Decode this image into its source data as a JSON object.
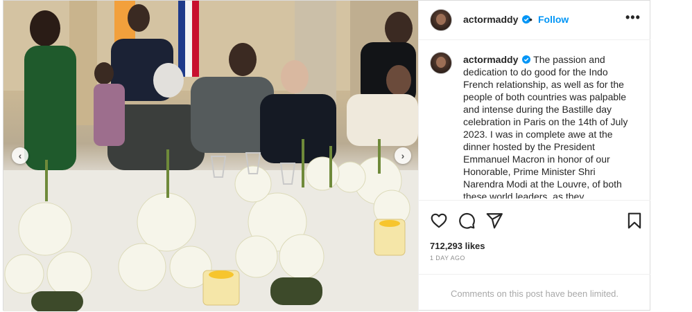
{
  "post": {
    "username": "actormaddy",
    "follow_label": "Follow",
    "separator": "•",
    "more_label": "•••",
    "caption_text": "The passion and dedication to do good for the Indo French relationship, as well as for the people of both countries was palpable and intense during the Bastille day celebration in Paris on the 14th of July 2023. I was in complete awe at the dinner hosted by the President Emmanuel Macron in honor of our Honorable, Prime Minister Shri Narendra Modi at the Louvre, of both these world leaders, as they",
    "likes": "712,293 likes",
    "time": "1 DAY AGO",
    "comments_limited": "Comments on this post have been limited."
  },
  "photo": {
    "prev_arrow": "‹",
    "next_arrow": "›"
  },
  "colors": {
    "accent": "#0095f6",
    "text": "#262626",
    "muted": "#8e8e8e",
    "border": "#dbdbdb"
  },
  "icons": [
    "verified-badge-icon",
    "heart-icon",
    "comment-icon",
    "share-icon",
    "bookmark-icon",
    "more-icon"
  ]
}
